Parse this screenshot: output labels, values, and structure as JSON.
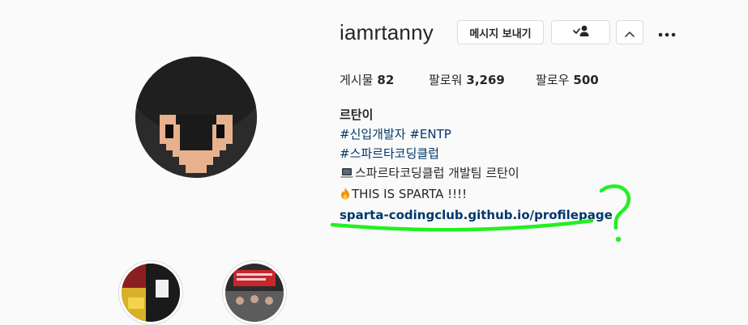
{
  "profile": {
    "username": "iamrtanny",
    "message_button_label": "메시지 보내기",
    "follow_status_icon": "person-check-icon",
    "suggest_toggle_icon": "chevron-up-icon",
    "more_options_icon": "more-horizontal-icon"
  },
  "stats": {
    "posts_label": "게시물",
    "posts_count": "82",
    "followers_label": "팔로워",
    "followers_count": "3,269",
    "following_label": "팔로우",
    "following_count": "500"
  },
  "bio": {
    "name": "르탄이",
    "hashtags_line1": "#신입개발자 #ENTP",
    "hashtags_line2": "#스파르타코딩클럽",
    "line3_icon": "laptop-emoji",
    "line3_text": "스파르타코딩클럽 개발팀 르탄이",
    "line4_icon": "fire-emoji",
    "line4_text": "THIS IS SPARTA !!!!",
    "link": "sparta-codingclub.github.io/profilepage"
  },
  "annotation": {
    "mark": "?",
    "color": "#22f022"
  },
  "highlights": [
    {
      "name": "highlight-1"
    },
    {
      "name": "highlight-2"
    }
  ]
}
